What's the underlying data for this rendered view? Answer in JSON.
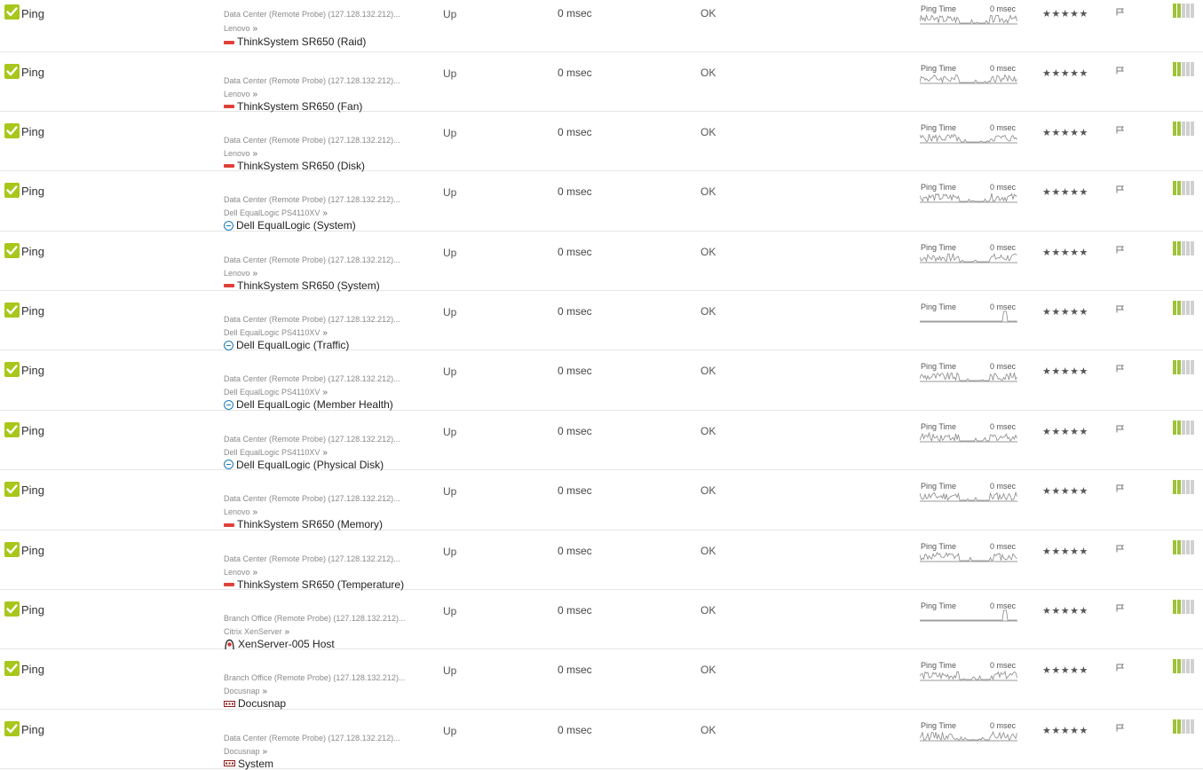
{
  "icons": {
    "check": "check-icon",
    "flag": "flag-icon",
    "vendor_lenovo": "lenovo-icon",
    "vendor_dell": "dell-icon",
    "vendor_citrix": "citrix-icon",
    "vendor_docusnap": "docusnap-icon"
  },
  "colors": {
    "check": "#a8c71c",
    "priority_on": "#9fc23a",
    "lenovo": "#e0403a",
    "dell": "#1a79b8"
  },
  "rows": [
    {
      "name": "Ping",
      "path": "Data Center (Remote Probe) (127.128.132.212)...",
      "parent": "Lenovo",
      "device": "ThinkSystem SR650 (Raid)",
      "vendor": "lenovo",
      "status": "Up",
      "last_value": "0 msec",
      "message": "OK",
      "spark_label": "Ping Time",
      "spark_value": "0 msec",
      "stars": "★★★★★",
      "priority": 5
    },
    {
      "name": "Ping",
      "path": "Data Center (Remote Probe) (127.128.132.212)...",
      "parent": "Lenovo",
      "device": "ThinkSystem SR650 (Fan)",
      "vendor": "lenovo",
      "status": "Up",
      "last_value": "0 msec",
      "message": "OK",
      "spark_label": "Ping Time",
      "spark_value": "0 msec",
      "stars": "★★★★★",
      "priority": 5
    },
    {
      "name": "Ping",
      "path": "Data Center (Remote Probe) (127.128.132.212)...",
      "parent": "Lenovo",
      "device": "ThinkSystem SR650 (Disk)",
      "vendor": "lenovo",
      "status": "Up",
      "last_value": "0 msec",
      "message": "OK",
      "spark_label": "Ping Time",
      "spark_value": "0 msec",
      "stars": "★★★★★",
      "priority": 5
    },
    {
      "name": "Ping",
      "path": "Data Center (Remote Probe) (127.128.132.212)...",
      "parent": "Dell EqualLogic PS4110XV",
      "device": "Dell EqualLogic (System)",
      "vendor": "dell",
      "status": "Up",
      "last_value": "0 msec",
      "message": "OK",
      "spark_label": "Ping Time",
      "spark_value": "0 msec",
      "stars": "★★★★★",
      "priority": 5
    },
    {
      "name": "Ping",
      "path": "Data Center (Remote Probe) (127.128.132.212)...",
      "parent": "Lenovo",
      "device": "ThinkSystem SR650 (System)",
      "vendor": "lenovo",
      "status": "Up",
      "last_value": "0 msec",
      "message": "OK",
      "spark_label": "Ping Time",
      "spark_value": "0 msec",
      "stars": "★★★★★",
      "priority": 5
    },
    {
      "name": "Ping",
      "path": "Data Center (Remote Probe) (127.128.132.212)...",
      "parent": "Dell EqualLogic PS4110XV",
      "device": "Dell EqualLogic (Traffic)",
      "vendor": "dell",
      "status": "Up",
      "last_value": "0 msec",
      "message": "OK",
      "spark_label": "Ping Time",
      "spark_value": "0 msec",
      "stars": "★★★★★",
      "priority": 5
    },
    {
      "name": "Ping",
      "path": "Data Center (Remote Probe) (127.128.132.212)...",
      "parent": "Dell EqualLogic PS4110XV",
      "device": "Dell EqualLogic (Member Health)",
      "vendor": "dell",
      "status": "Up",
      "last_value": "0 msec",
      "message": "OK",
      "spark_label": "Ping Time",
      "spark_value": "0 msec",
      "stars": "★★★★★",
      "priority": 5
    },
    {
      "name": "Ping",
      "path": "Data Center (Remote Probe) (127.128.132.212)...",
      "parent": "Dell EqualLogic PS4110XV",
      "device": "Dell EqualLogic (Physical Disk)",
      "vendor": "dell",
      "status": "Up",
      "last_value": "0 msec",
      "message": "OK",
      "spark_label": "Ping Time",
      "spark_value": "0 msec",
      "stars": "★★★★★",
      "priority": 5
    },
    {
      "name": "Ping",
      "path": "Data Center (Remote Probe) (127.128.132.212)...",
      "parent": "Lenovo",
      "device": "ThinkSystem SR650 (Memory)",
      "vendor": "lenovo",
      "status": "Up",
      "last_value": "0 msec",
      "message": "OK",
      "spark_label": "Ping Time",
      "spark_value": "0 msec",
      "stars": "★★★★★",
      "priority": 5
    },
    {
      "name": "Ping",
      "path": "Data Center (Remote Probe) (127.128.132.212)...",
      "parent": "Lenovo",
      "device": "ThinkSystem SR650 (Temperature)",
      "vendor": "lenovo",
      "status": "Up",
      "last_value": "0 msec",
      "message": "OK",
      "spark_label": "Ping Time",
      "spark_value": "0 msec",
      "stars": "★★★★★",
      "priority": 5
    },
    {
      "name": "Ping",
      "path": "Branch Office (Remote Probe) (127.128.132.212)...",
      "parent": "Citrix XenServer",
      "device": "XenServer-005 Host",
      "vendor": "citrix",
      "status": "Up",
      "last_value": "0 msec",
      "message": "OK",
      "spark_label": "Ping Time",
      "spark_value": "0 msec",
      "stars": "★★★★★",
      "priority": 5
    },
    {
      "name": "Ping",
      "path": "Branch Office (Remote Probe) (127.128.132.212)...",
      "parent": "Docusnap",
      "device": "Docusnap",
      "vendor": "docusnap",
      "status": "Up",
      "last_value": "0 msec",
      "message": "OK",
      "spark_label": "Ping Time",
      "spark_value": "0 msec",
      "stars": "★★★★★",
      "priority": 5
    },
    {
      "name": "Ping",
      "path": "Data Center (Remote Probe) (127.128.132.212)...",
      "parent": "Docusnap",
      "device": "System",
      "vendor": "docusnap",
      "status": "Up",
      "last_value": "0 msec",
      "message": "OK",
      "spark_label": "Ping Time",
      "spark_value": "0 msec",
      "stars": "★★★★★",
      "priority": 5
    }
  ]
}
